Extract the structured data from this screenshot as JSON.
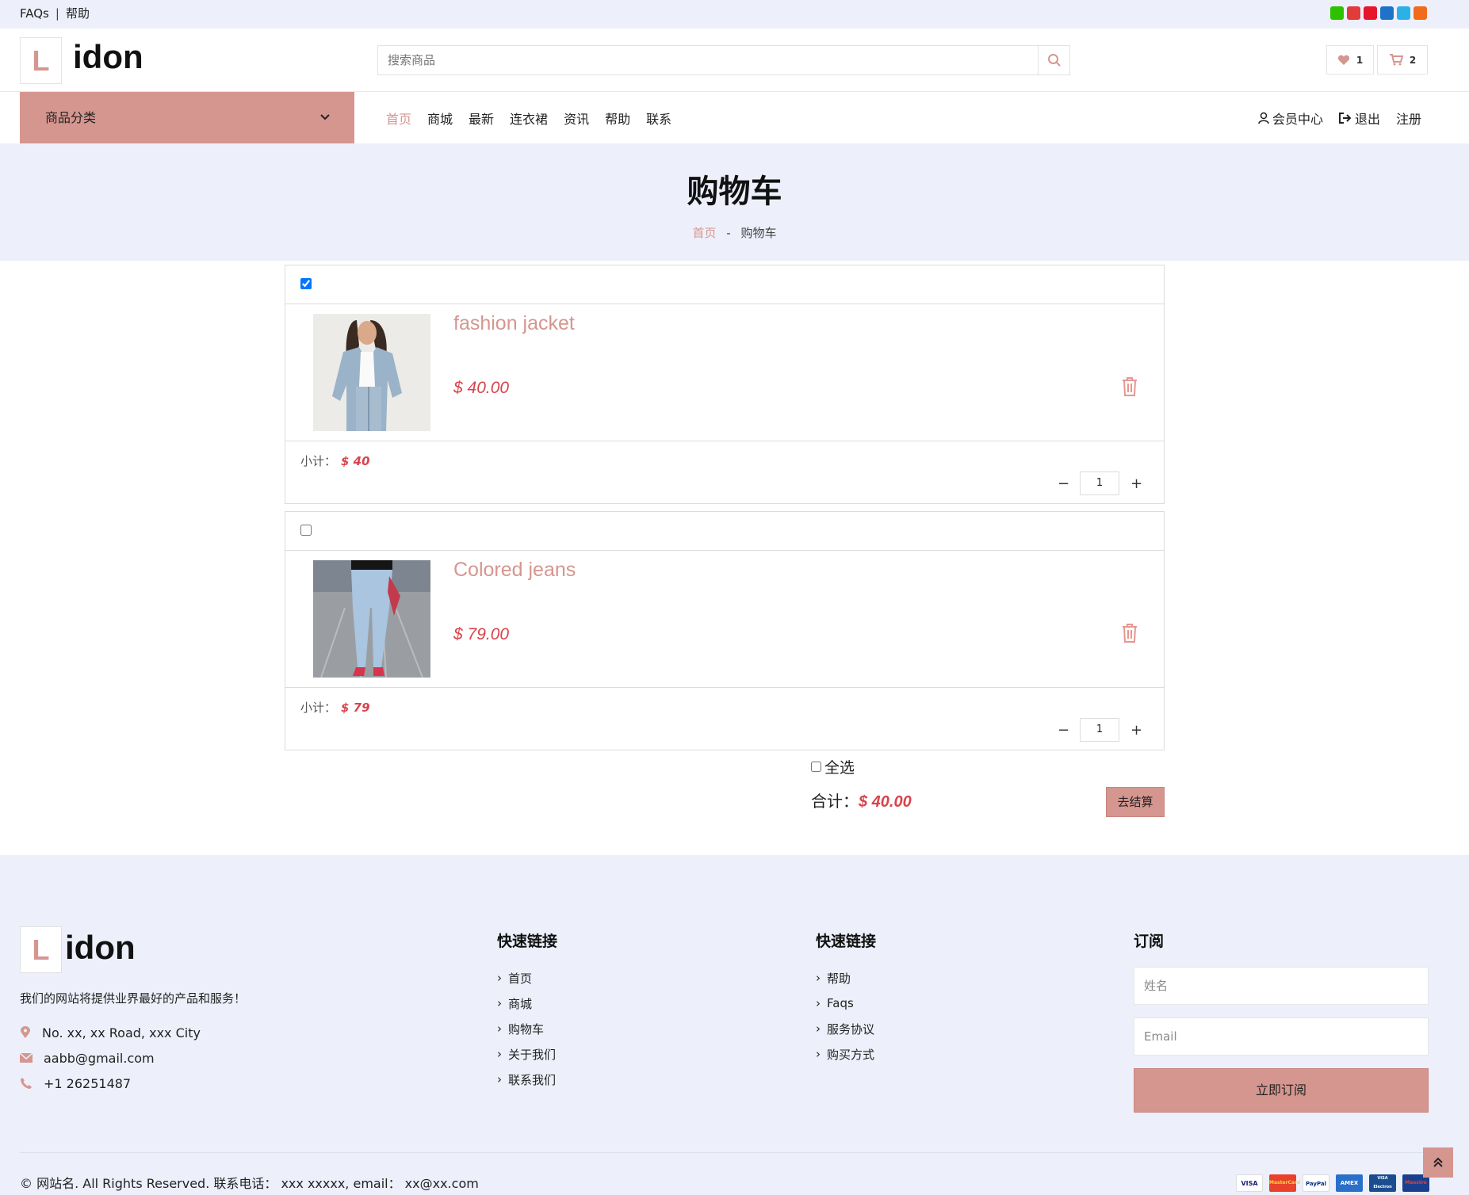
{
  "topbar": {
    "faqs": "FAQs",
    "sep": "|",
    "help": "帮助"
  },
  "social": [
    {
      "icon": "wechat-icon",
      "color": "#2dc100"
    },
    {
      "icon": "qq-icon",
      "color": "#e23b3b"
    },
    {
      "icon": "weibo-icon",
      "color": "#e6162d"
    },
    {
      "icon": "renren-icon",
      "color": "#1e73c9"
    },
    {
      "icon": "qzone-icon",
      "color": "#2bb1e6"
    },
    {
      "icon": "more-share-icon",
      "color": "#f26a1b"
    }
  ],
  "header": {
    "logo_letter": "L",
    "logo_text": "idon",
    "search_placeholder": "搜索商品",
    "wishlist_count": "1",
    "cart_count": "2"
  },
  "nav": {
    "category": "商品分类",
    "menu": [
      "首页",
      "商城",
      "最新",
      "连衣裙",
      "资讯",
      "帮助",
      "联系"
    ],
    "member": "会员中心",
    "logout": "退出",
    "register": "注册"
  },
  "hero": {
    "title": "购物车",
    "crumb_home": "首页",
    "crumb_sep": "-",
    "crumb_current": "购物车"
  },
  "cart": {
    "subtotal_label": "小计：",
    "items": [
      {
        "name": "fashion jacket",
        "price": "$ 40.00",
        "subtotal": "$ 40",
        "qty": "1",
        "checked": true
      },
      {
        "name": "Colored jeans",
        "price": "$ 79.00",
        "subtotal": "$ 79",
        "qty": "1",
        "checked": false
      }
    ],
    "select_all": "全选",
    "total_label": "合计：",
    "total_value": "$ 40.00",
    "checkout": "去结算"
  },
  "footer": {
    "logo_letter": "L",
    "logo_text": "idon",
    "desc": "我们的网站将提供业界最好的产品和服务！",
    "address": "No. xx, xx Road, xxx City",
    "email": "aabb@gmail.com",
    "phone": "+1 26251487",
    "col1": {
      "title": "快速链接",
      "links": [
        "首页",
        "商城",
        "购物车",
        "关于我们",
        "联系我们"
      ]
    },
    "col2": {
      "title": "快速链接",
      "links": [
        "帮助",
        "Faqs",
        "服务协议",
        "购买方式"
      ]
    },
    "subscribe": {
      "title": "订阅",
      "name_placeholder": "姓名",
      "email_placeholder": "Email",
      "button": "立即订阅"
    },
    "copyright": "© 网站名. All Rights Reserved. 联系电话： xxx xxxxx,  email： xx@xx.com",
    "payments": [
      "VISA",
      "MasterCard",
      "PayPal",
      "AMEX",
      "VISA Electron",
      "Maestro"
    ]
  },
  "colors": {
    "accent": "#d5968f",
    "price": "#d9434b",
    "bg_light": "#edf0fb"
  }
}
